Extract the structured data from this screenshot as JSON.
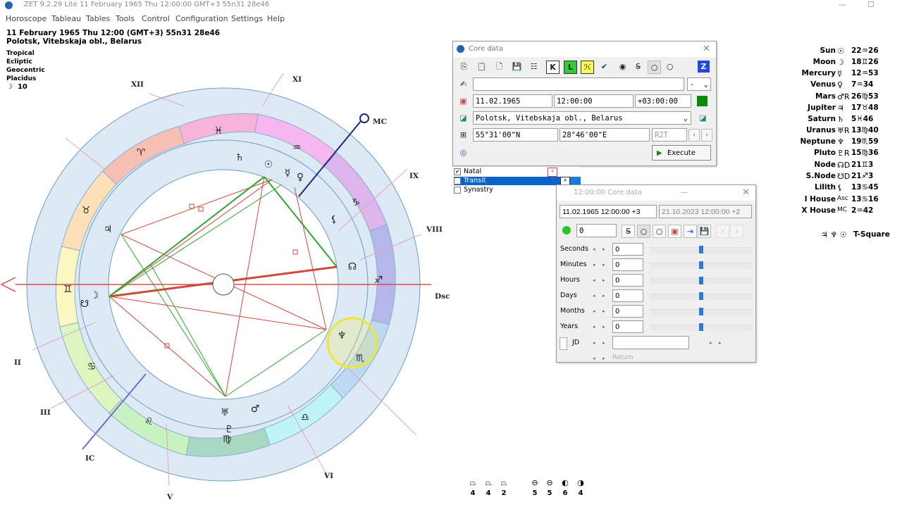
{
  "titlebar": {
    "text": "ZET 9.2.29 Lite   11 February 1965  Thu  12:00:00 GMT+3 55n31  28e46"
  },
  "menu": [
    "Horoscope",
    "Tableau",
    "Tables",
    "Tools",
    "Control",
    "Configuration",
    "Settings",
    "Help"
  ],
  "header": {
    "line1": "11 February 1965  Thu  12:00 (GMT+3) 55n31  28e46",
    "line2": "Polotsk, Vitebskaja obl., Belarus",
    "settings": [
      "Tropical",
      "Ecliptic",
      "Geocentric",
      "Placidus"
    ],
    "moon_day": "10"
  },
  "chart": {
    "houses": {
      "mc": "MC",
      "xi": "XI",
      "xii": "XII",
      "ix": "IX",
      "viii": "VIII",
      "dsc": "Dsc",
      "ii": "II",
      "iii": "III",
      "ic": "IC",
      "v": "V",
      "vi": "VI"
    },
    "colors": {
      "outer_ring": "#dde9f4",
      "aspect_red": "#d04a3a",
      "aspect_green": "#2fa52f",
      "mc_line": "#1a2a80",
      "ic_line": "#6b6ed8",
      "highlight": "#f2ee44"
    },
    "sign_glyphs": {
      "pisces": "♓",
      "aquarius": "♒",
      "capricorn": "♑",
      "sagittarius": "♐",
      "scorpio": "♏",
      "libra": "♎",
      "virgo": "♍",
      "leo": "♌",
      "cancer": "♋",
      "gemini": "♊",
      "taurus": "♉",
      "aries": "♈"
    },
    "planet_glyphs": {
      "saturn": "♄",
      "sun": "☉",
      "venus": "♀",
      "mercury": "☿",
      "lilith": "⚸",
      "jupiter": "♃",
      "moon": "☽",
      "node": "☊",
      "uranus": "♅",
      "mars": "♂",
      "pluto": "♇",
      "neptune": "♆",
      "snode": "☋"
    }
  },
  "planets": [
    {
      "name": "Sun",
      "glyph": "☉",
      "pos": "22♒26"
    },
    {
      "name": "Moon",
      "glyph": "☽",
      "pos": "18♊26"
    },
    {
      "name": "Mercury",
      "glyph": "☿",
      "pos": "12♒53"
    },
    {
      "name": "Venus",
      "glyph": "♀",
      "pos": "7♒34"
    },
    {
      "name": "Mars",
      "glyph": "♂R",
      "pos": "26♍53"
    },
    {
      "name": "Jupiter",
      "glyph": "♃",
      "pos": "17♉48"
    },
    {
      "name": "Saturn",
      "glyph": "♄",
      "pos": "5♓46"
    },
    {
      "name": "Uranus",
      "glyph": "♅R",
      "pos": "13♍40"
    },
    {
      "name": "Neptune",
      "glyph": "♆",
      "pos": "19♏59"
    },
    {
      "name": "Pluto",
      "glyph": "♇R",
      "pos": "15♍36"
    },
    {
      "name": "Node",
      "glyph": "☊D",
      "pos": "21♊3"
    },
    {
      "name": "S.Node",
      "glyph": "☋D",
      "pos": "21♐3"
    },
    {
      "name": "Lilith",
      "glyph": "⚸",
      "pos": "13♋45"
    },
    {
      "name": "I House",
      "glyph": "Asc",
      "pos": "13♋16"
    },
    {
      "name": "X House",
      "glyph": "MC",
      "pos": "2♒42"
    }
  ],
  "tsquare": {
    "glyphs": "♃ ♆ ☉",
    "label": "T-Square"
  },
  "core": {
    "title": "Core data",
    "date": "11.02.1965",
    "time": "12:00:00",
    "tz": "+03:00:00",
    "place": "Polotsk, Vitebskaja obl., Belarus",
    "lat": "55°31'00\"N",
    "lon": "28°46'00\"E",
    "r2t": "R2T",
    "dash": "-",
    "execute": "Execute",
    "toolbar_k": "K",
    "toolbar_l": "L",
    "toolbar_z": "Z"
  },
  "list": {
    "natal": "Natal",
    "transit": "Transit",
    "synastry": "Synastry"
  },
  "core2": {
    "title": "12:00:00 Core data",
    "natal_field": "11.02.1965  12:00:00  +3",
    "transit_field": "21.10.2023   12:00:00  +2",
    "counter": "0",
    "rows": [
      {
        "label": "Seconds",
        "value": "0"
      },
      {
        "label": "Minutes",
        "value": "0"
      },
      {
        "label": "Hours",
        "value": "0"
      },
      {
        "label": "Days",
        "value": "0"
      },
      {
        "label": "Months",
        "value": "0"
      },
      {
        "label": "Years",
        "value": "0"
      }
    ],
    "jd_label": "JD",
    "return_label": "Return"
  },
  "bottom_counts": [
    "4",
    "4",
    "2",
    "5",
    "5",
    "6",
    "4"
  ]
}
